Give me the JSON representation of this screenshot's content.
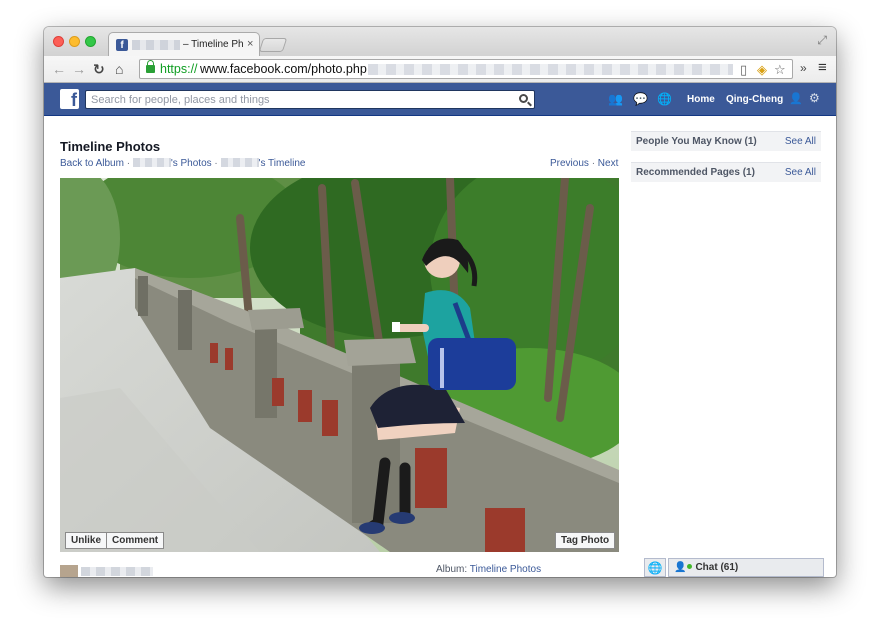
{
  "browser": {
    "tab_title": "– Timeline Ph",
    "tab_close": "×",
    "url_scheme": "https://",
    "url_host": "www.facebook.com/photo.php",
    "favicon_letter": "f"
  },
  "header": {
    "logo": "f",
    "search_placeholder": "Search for people, places and things",
    "home_label": "Home",
    "user_name": "Qing-Cheng",
    "brand_color": "#3b5998"
  },
  "page": {
    "title": "Timeline Photos",
    "crumbs": {
      "back": "Back to Album",
      "photos_suffix": "'s Photos",
      "timeline_suffix": "'s Timeline"
    },
    "pager": {
      "previous": "Previous",
      "next": "Next"
    }
  },
  "photo_actions": {
    "unlike": "Unlike",
    "comment": "Comment",
    "tag": "Tag Photo"
  },
  "sidebar": {
    "boxes": [
      {
        "title": "People You May Know (1)",
        "link": "See All"
      },
      {
        "title": "Recommended Pages (1)",
        "link": "See All"
      }
    ]
  },
  "footer": {
    "album_label": "Album:",
    "album_link": "Timeline Photos",
    "chat_label": "Chat (61)"
  }
}
